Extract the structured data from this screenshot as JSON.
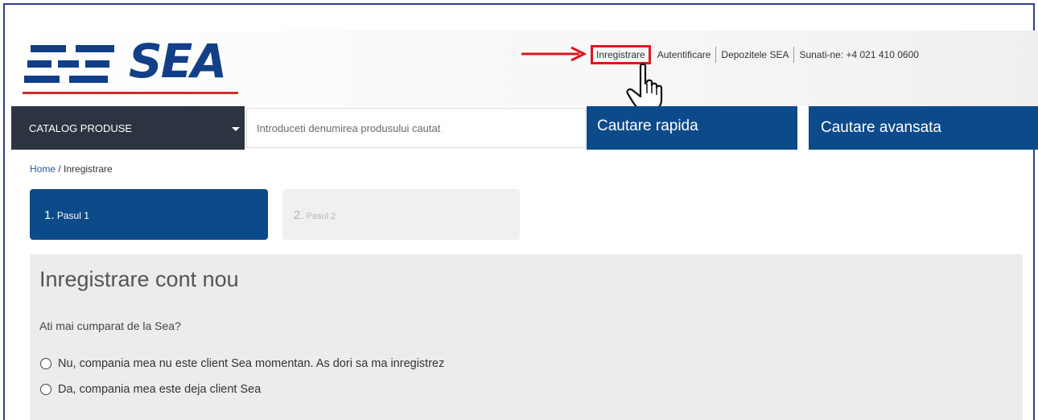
{
  "brand": {
    "logo_text": "SEA",
    "colors": {
      "primary": "#0d4a8a",
      "dark": "#2c3441",
      "accent_red": "#e0161e"
    }
  },
  "top_links": {
    "register": "Inregistrare",
    "login": "Autentificare",
    "warehouses": "Depozitele SEA",
    "phone": "Sunati-ne: +4 021 410 0600"
  },
  "annotation": {
    "arrow": "red-arrow-icon",
    "cursor": "hand-pointer-icon"
  },
  "nav": {
    "catalog_label": "CATALOG PRODUSE",
    "search_placeholder": "Introduceti denumirea produsului cautat",
    "quick_search": "Cautare rapida",
    "advanced_search": "Cautare avansata"
  },
  "breadcrumb": {
    "home": "Home",
    "separator": " / ",
    "current": "Inregistrare"
  },
  "steps": [
    {
      "num": "1.",
      "label": "Pasul 1",
      "active": true
    },
    {
      "num": "2.",
      "label": "Pasul 2",
      "active": false
    }
  ],
  "form": {
    "title": "Inregistrare cont nou",
    "question": "Ati mai cumparat de la Sea?",
    "options": [
      "Nu, compania mea nu este client Sea momentan. As dori sa ma inregistrez",
      "Da, compania mea este deja client Sea"
    ]
  }
}
